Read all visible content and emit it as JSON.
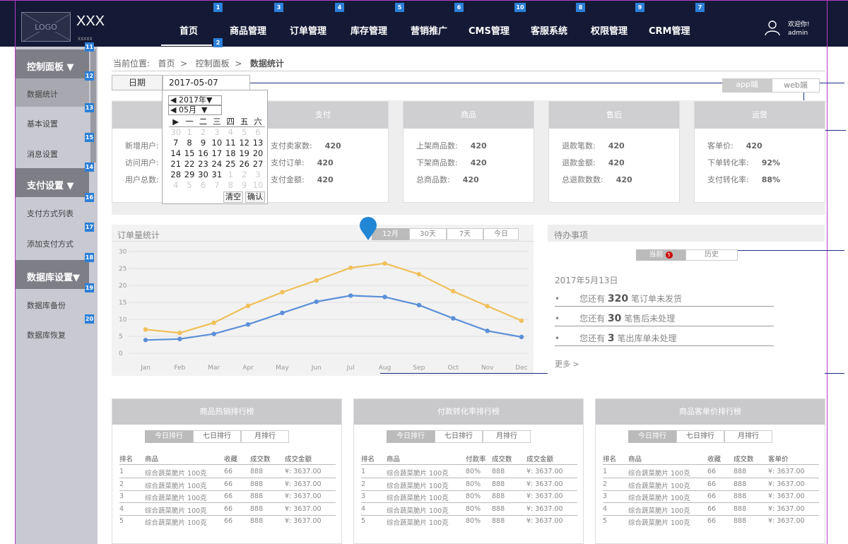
{
  "header": {
    "logo_text": "LOGO",
    "brand": "XXX",
    "brand_sub": "XXXXX",
    "nav": [
      "首页",
      "商品管理",
      "订单管理",
      "库存管理",
      "营销推广",
      "CMS管理",
      "客服系统",
      "权限管理",
      "CRM管理"
    ],
    "nav_badges": [
      "1",
      "3",
      "4",
      "5",
      "6",
      "10",
      "8",
      "9",
      "7"
    ],
    "home_badge": "2",
    "welcome": "欢迎你!",
    "username": "admin"
  },
  "sidebar": {
    "groups": [
      {
        "title": "控制面板",
        "badge": "11",
        "items": [
          {
            "label": "数据统计",
            "badge": "12"
          },
          {
            "label": "基本设置",
            "badge": "13"
          },
          {
            "label": "消息设置",
            "badge": "15"
          }
        ]
      },
      {
        "title": "支付设置",
        "badge": "14",
        "items": [
          {
            "label": "支付方式列表",
            "badge": "16"
          },
          {
            "label": "添加支付方式",
            "badge": "17"
          }
        ]
      },
      {
        "title": "数据库设置",
        "badge": "18",
        "items": [
          {
            "label": "数据库备份",
            "badge": "19"
          },
          {
            "label": "数据库恢复",
            "badge": "20"
          }
        ]
      }
    ]
  },
  "breadcrumb": {
    "prefix": "当前位置:",
    "items": [
      "首页",
      "控制面板",
      "数据统计"
    ],
    "sep": ">"
  },
  "date_filter": {
    "label": "日期",
    "value": "2017-05-07"
  },
  "platform_toggle": {
    "options": [
      "app端",
      "web端"
    ],
    "active": 0
  },
  "calendar": {
    "year": "2017年",
    "month": "05月",
    "weekdays": [
      "日",
      "一",
      "二",
      "三",
      "四",
      "五",
      "六"
    ],
    "weeks": [
      [
        "30",
        "1",
        "2",
        "3",
        "4",
        "5",
        "6"
      ],
      [
        "7",
        "8",
        "9",
        "10",
        "11",
        "12",
        "13"
      ],
      [
        "14",
        "15",
        "16",
        "17",
        "18",
        "19",
        "20"
      ],
      [
        "21",
        "22",
        "23",
        "24",
        "25",
        "26",
        "27"
      ],
      [
        "28",
        "29",
        "30",
        "31",
        "1",
        "2",
        "3"
      ],
      [
        "4",
        "5",
        "6",
        "7",
        "8",
        "9",
        "10"
      ]
    ],
    "clear": "清空",
    "confirm": "确认"
  },
  "stats_cards": [
    {
      "title": "",
      "rows": [
        {
          "label": "新增用户:",
          "value": ""
        },
        {
          "label": "访问用户:",
          "value": ""
        },
        {
          "label": "用户总数:",
          "value": ""
        }
      ]
    },
    {
      "title": "支付",
      "rows": [
        {
          "label": "支付卖家数:",
          "value": "420"
        },
        {
          "label": "支付订单:",
          "value": "420"
        },
        {
          "label": "支付金额:",
          "value": "420"
        }
      ]
    },
    {
      "title": "商品",
      "rows": [
        {
          "label": "上架商品数:",
          "value": "420"
        },
        {
          "label": "下架商品数:",
          "value": "420"
        },
        {
          "label": "总商品数:",
          "value": "420"
        }
      ]
    },
    {
      "title": "售后",
      "rows": [
        {
          "label": "退款笔数:",
          "value": "420"
        },
        {
          "label": "退款金额:",
          "value": "420"
        },
        {
          "label": "总退款数数:",
          "value": "420"
        }
      ]
    },
    {
      "title": "运营",
      "rows": [
        {
          "label": "客单价:",
          "value": "420"
        },
        {
          "label": "下单转化率:",
          "value": "92%"
        },
        {
          "label": "支付转化率:",
          "value": "88%"
        }
      ]
    }
  ],
  "order_chart": {
    "title": "订单量统计",
    "ranges": [
      "12月",
      "30天",
      "7天",
      "今日"
    ],
    "active_range": 0
  },
  "chart_data": {
    "type": "line",
    "categories": [
      "Jan",
      "Feb",
      "Mar",
      "Apr",
      "May",
      "Jun",
      "Jul",
      "Aug",
      "Sep",
      "Oct",
      "Nov",
      "Dec"
    ],
    "series": [
      {
        "values": [
          7,
          6,
          9,
          14,
          18,
          21.5,
          25.2,
          26.5,
          23.3,
          18.3,
          13.9,
          9.6
        ],
        "color": "#f0c05a"
      },
      {
        "values": [
          3.9,
          4.2,
          5.7,
          8.5,
          11.9,
          15.2,
          17,
          16.6,
          14.2,
          10.3,
          6.6,
          4.8
        ],
        "color": "#5b8fd8"
      }
    ],
    "yticks": [
      0,
      5,
      10,
      15,
      20,
      25,
      30
    ],
    "ylim": [
      0,
      30
    ],
    "grid": true
  },
  "todo": {
    "title": "待办事项",
    "tabs": [
      "当前",
      "历史"
    ],
    "current_count": "5",
    "date": "2017年5月13日",
    "items": [
      {
        "pre": "您还有",
        "num": "320",
        "post": "笔订单未发货"
      },
      {
        "pre": "您还有",
        "num": "30",
        "post": "笔售后未处理"
      },
      {
        "pre": "您还有",
        "num": "3",
        "post": "笔出库单未处理"
      }
    ],
    "more": "更多 >"
  },
  "rankings": [
    {
      "title": "商品热销排行榜",
      "tabs": [
        "今日排行",
        "七日排行",
        "月排行"
      ],
      "columns": [
        "排名",
        "商品",
        "收藏",
        "成交数",
        "成交金额"
      ],
      "rows": [
        [
          "1",
          "综合蔬菜脆片 100克",
          "66",
          "888",
          "¥: 3637.00"
        ],
        [
          "2",
          "综合蔬菜脆片 100克",
          "66",
          "888",
          "¥: 3637.00"
        ],
        [
          "3",
          "综合蔬菜脆片 100克",
          "66",
          "888",
          "¥: 3637.00"
        ],
        [
          "4",
          "综合蔬菜脆片 100克",
          "66",
          "888",
          "¥: 3637.00"
        ],
        [
          "5",
          "综合蔬菜脆片 100克",
          "66",
          "888",
          "¥: 3637.00"
        ]
      ]
    },
    {
      "title": "付款转化率排行榜",
      "tabs": [
        "今日排行",
        "七日排行",
        "月排行"
      ],
      "columns": [
        "排名",
        "商品",
        "付款率",
        "成交数",
        "成交金额"
      ],
      "rows": [
        [
          "1",
          "综合蔬菜脆片 100克",
          "80%",
          "888",
          "¥: 3637.00"
        ],
        [
          "2",
          "综合蔬菜脆片 100克",
          "80%",
          "888",
          "¥: 3637.00"
        ],
        [
          "3",
          "综合蔬菜脆片 100克",
          "80%",
          "888",
          "¥: 3637.00"
        ],
        [
          "4",
          "综合蔬菜脆片 100克",
          "80%",
          "888",
          "¥: 3637.00"
        ],
        [
          "5",
          "综合蔬菜脆片 100克",
          "80%",
          "888",
          "¥: 3637.00"
        ]
      ]
    },
    {
      "title": "商品客单价排行榜",
      "tabs": [
        "今日排行",
        "七日排行",
        "月排行"
      ],
      "columns": [
        "排名",
        "商品",
        "收藏",
        "成交数",
        "客单价"
      ],
      "rows": [
        [
          "1",
          "综合蔬菜脆片 100克",
          "66",
          "888",
          "¥: 3637.00"
        ],
        [
          "2",
          "综合蔬菜脆片 100克",
          "66",
          "888",
          "¥: 3637.00"
        ],
        [
          "3",
          "综合蔬菜脆片 100克",
          "66",
          "888",
          "¥: 3637.00"
        ],
        [
          "4",
          "综合蔬菜脆片 100克",
          "66",
          "888",
          "¥: 3637.00"
        ],
        [
          "5",
          "综合蔬菜脆片 100克",
          "66",
          "888",
          "¥: 3637.00"
        ]
      ]
    }
  ]
}
